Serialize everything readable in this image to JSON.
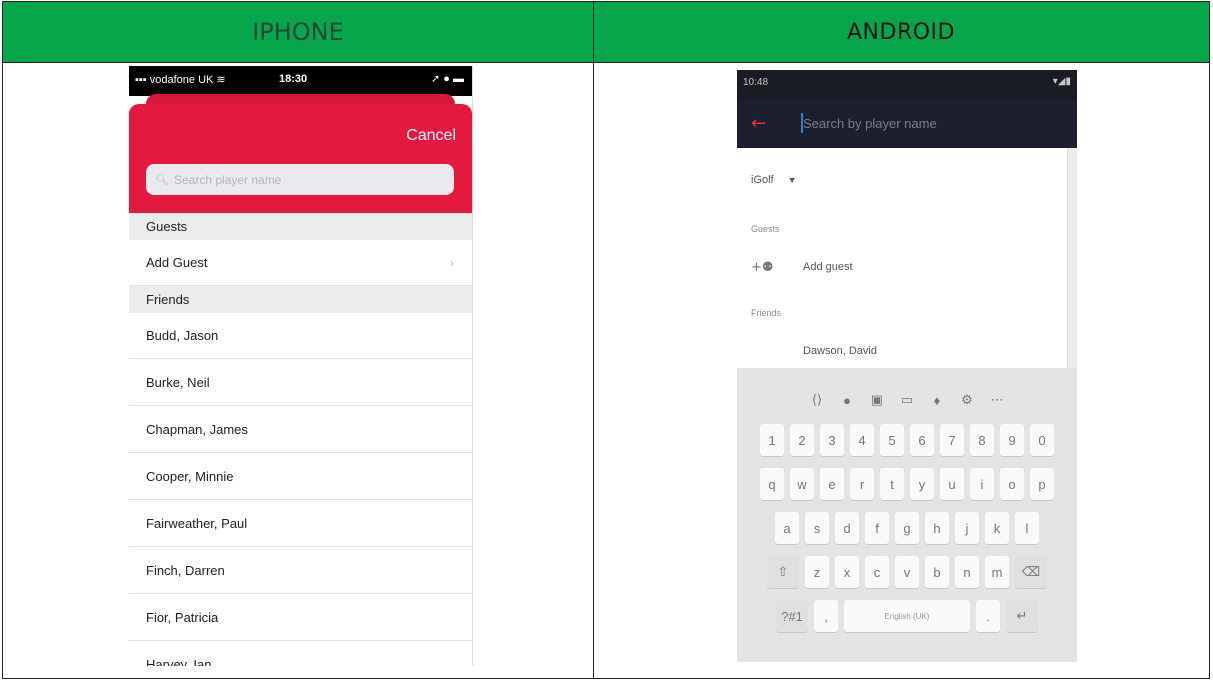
{
  "table": {
    "left_header": "IPHONE",
    "right_header": "ANDROID",
    "colors": {
      "header_bg": "#08a64b",
      "iphone_accent": "#e3193f",
      "android_toolbar": "#1b1f2e"
    }
  },
  "iphone": {
    "status": {
      "carrier": "vodafone UK",
      "time": "18:30",
      "icons": "wifi-icon battery-icon"
    },
    "cancel_label": "Cancel",
    "search_placeholder": "Search player name",
    "sections": [
      {
        "title": "Guests"
      },
      {
        "title": "Friends"
      }
    ],
    "add_guest_label": "Add Guest",
    "friends": [
      "Budd, Jason",
      "Burke, Neil",
      "Chapman, James",
      "Cooper, Minnie",
      "Fairweather, Paul",
      "Finch, Darren",
      "Fior, Patricia",
      "Harvey, Ian"
    ]
  },
  "android": {
    "status": {
      "time": "10:48"
    },
    "search_placeholder": "Search by player name",
    "club_selector": "iGolf",
    "guests_label": "Guests",
    "add_guest_label": "Add guest",
    "friends_label": "Friends",
    "friends": [
      "Dawson, David"
    ],
    "keyboard": {
      "digits": [
        "1",
        "2",
        "3",
        "4",
        "5",
        "6",
        "7",
        "8",
        "9",
        "0"
      ],
      "row1": [
        "q",
        "w",
        "e",
        "r",
        "t",
        "y",
        "u",
        "i",
        "o",
        "p"
      ],
      "row2": [
        "a",
        "s",
        "d",
        "f",
        "g",
        "h",
        "j",
        "k",
        "l"
      ],
      "row3": [
        "z",
        "x",
        "c",
        "v",
        "b",
        "n",
        "m"
      ],
      "symbols_key": "?#1",
      "space_label": "English (UK)",
      "comma": ",",
      "period": "."
    }
  }
}
